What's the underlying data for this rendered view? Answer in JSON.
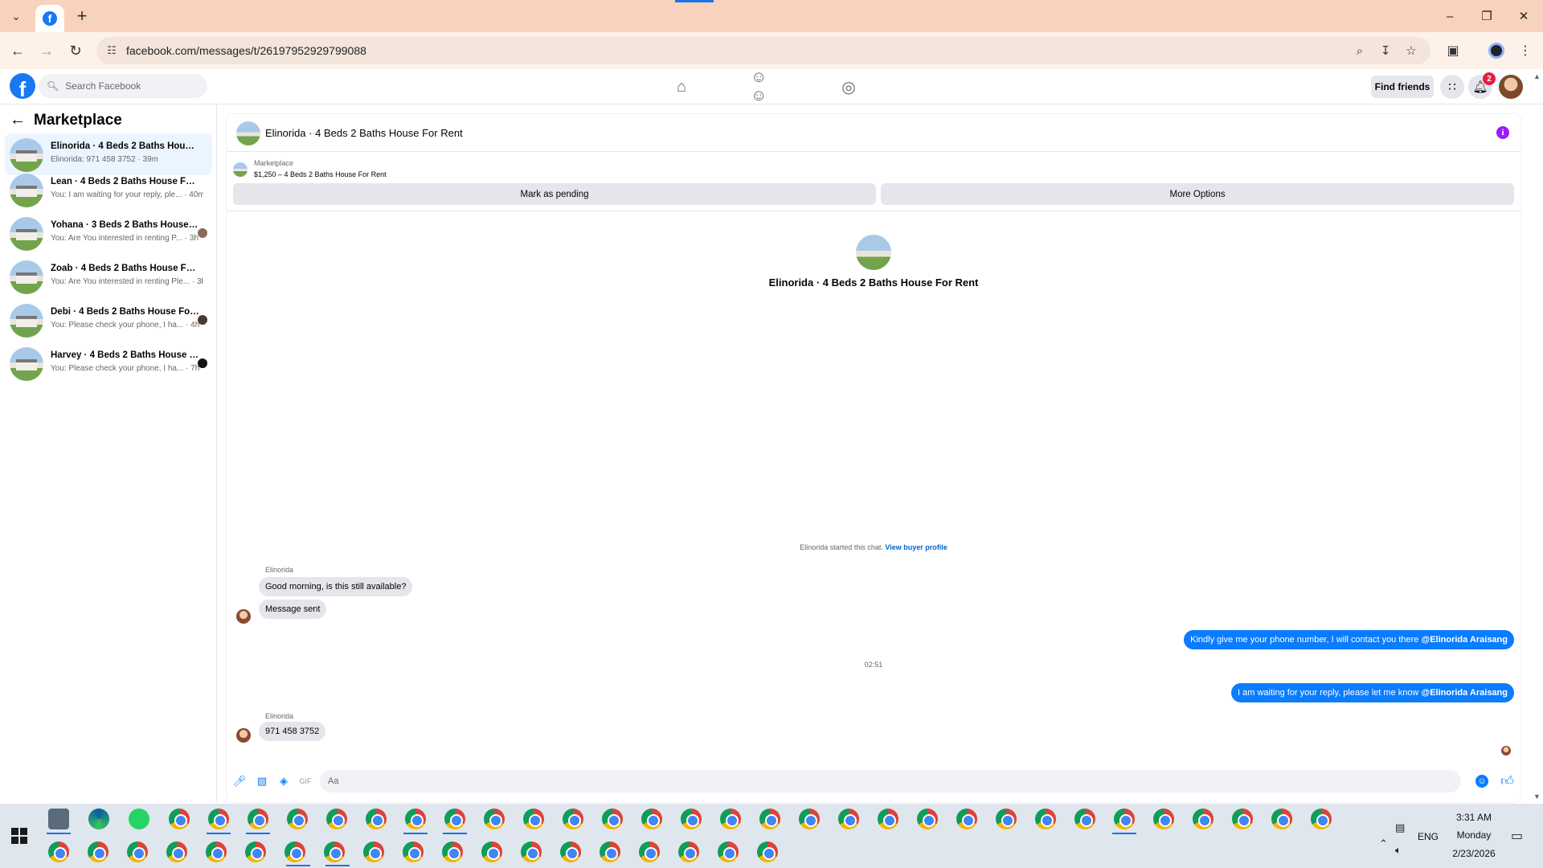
{
  "browser": {
    "url": "facebook.com/messages/t/26197952929799088",
    "tab_icon": "facebook-icon"
  },
  "fb_header": {
    "search_placeholder": "Search Facebook",
    "find_friends": "Find friends",
    "notification_count": "2"
  },
  "sidebar": {
    "title": "Marketplace",
    "conversations": [
      {
        "name": "Elinorida · 4 Beds 2 Baths House F...",
        "preview": "Elinorida: 971 458 3752 · 39m",
        "active": true
      },
      {
        "name": "Lean · 4 Beds 2 Baths House For R...",
        "preview": "You: I am waiting for your reply, ple... · 40m"
      },
      {
        "name": "Yohana · 3 Beds 2 Baths House F...",
        "preview": "You: Are You interested in renting P... · 3h"
      },
      {
        "name": "Zoab · 4 Beds 2 Baths House For R...",
        "preview": "You: Are You interested in renting Ple... · 3h"
      },
      {
        "name": "Debi · 4 Beds 2 Baths House For...",
        "preview": "You: Please check your phone, I ha... · 4h"
      },
      {
        "name": "Harvey · 4 Beds 2 Baths House F...",
        "preview": "You: Please check your phone, I ha... · 7h"
      }
    ]
  },
  "chat": {
    "title": "Elinorida · 4 Beds 2 Baths House For Rent",
    "listing_label": "Marketplace",
    "listing_price": "$1,250 – 4 Beds 2 Baths House For Rent",
    "mark_pending": "Mark as pending",
    "more_options": "More Options",
    "profile_title": "Elinorida · 4 Beds 2 Baths House For Rent",
    "started_text": "Elinorida started this chat.",
    "view_buyer_profile": "View buyer profile",
    "sender_name": "Elinorida",
    "msg1": "Good morning, is this still available?",
    "msg2": "Message sent",
    "out1_text": "Kindly give me your phone number, I will contact you there ",
    "out1_mention": "@Elinorida Araisang",
    "timestamp": "02:51",
    "out2_text": "I am waiting for your reply, please let me know ",
    "out2_mention": "@Elinorida Araisang",
    "sender_name2": "Elinorida",
    "msg3": "971 458 3752",
    "composer_placeholder": "Aa"
  },
  "taskbar": {
    "language": "ENG",
    "time": "3:31 AM",
    "day": "Monday",
    "date": "2/23/2026"
  }
}
